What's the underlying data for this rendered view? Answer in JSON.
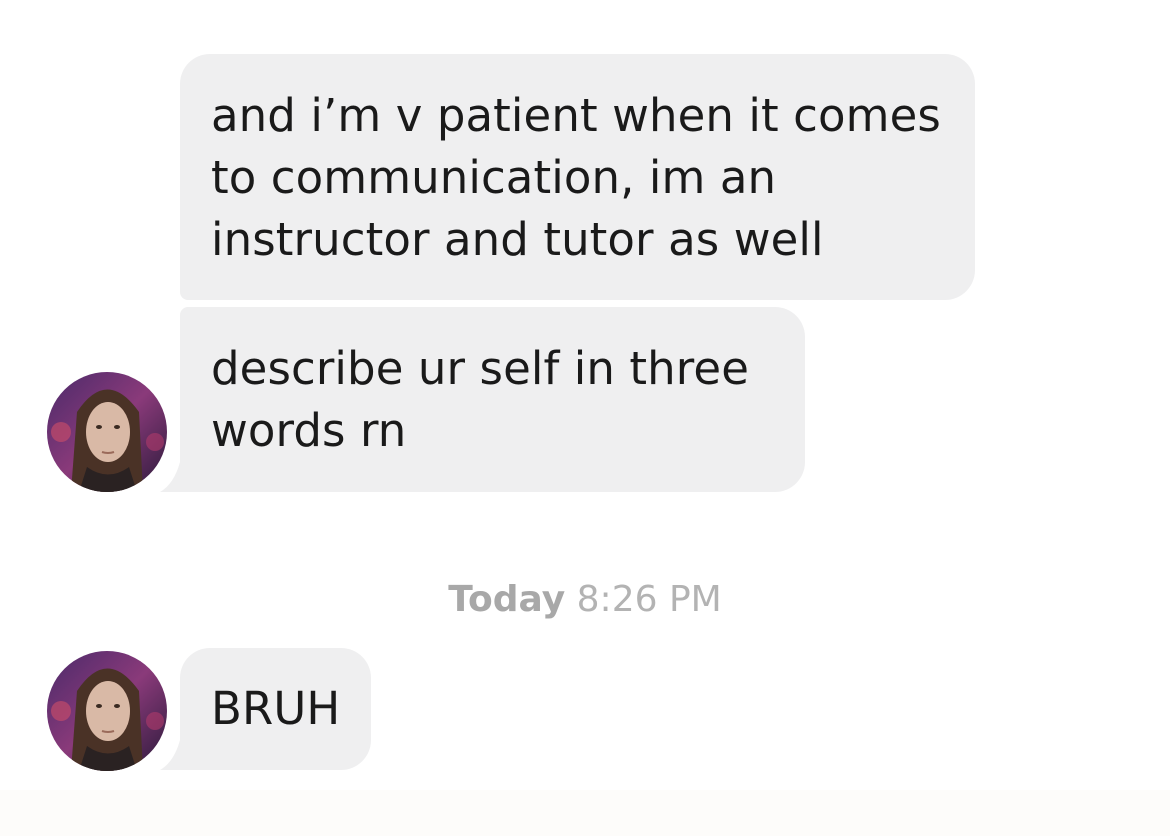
{
  "messages": [
    {
      "text": "and i’m v patient when it comes\nto communication, im an\ninstructor and tutor as well"
    },
    {
      "text": "describe ur self in three\nwords rn"
    },
    {
      "text": "BRUH"
    }
  ],
  "timestamp": {
    "day": "Today",
    "time": "8:26 PM"
  },
  "colors": {
    "bubble": "#efeff0",
    "text": "#1a1a1a",
    "timestamp": "#b3b3b3",
    "background": "#ffffff"
  }
}
